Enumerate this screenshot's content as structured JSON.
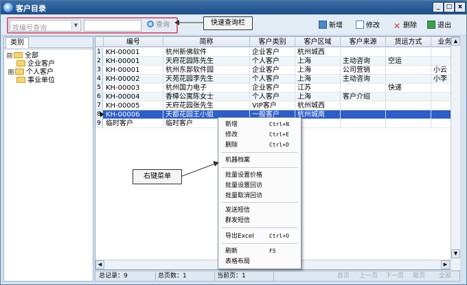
{
  "window": {
    "title": "客户目录"
  },
  "window_controls": {
    "minimize": "_",
    "maximize": "□",
    "close": "x"
  },
  "toolbar": {
    "search_placeholder": "按编号查询",
    "search_button": "查询",
    "add_label": "新增",
    "edit_label": "修改",
    "delete_label": "删除",
    "exit_label": "退出"
  },
  "annotations": {
    "quick_query_bar": "快速查询栏",
    "right_click_menu": "右键菜单"
  },
  "left_pane": {
    "tab_label": "类别",
    "tree": [
      {
        "label": "全部",
        "expander": "⊟"
      },
      {
        "label": "企业客户"
      },
      {
        "label": "个人客户",
        "expander": "⊞"
      },
      {
        "label": "事业单位"
      }
    ]
  },
  "grid": {
    "columns": [
      "编号",
      "简称",
      "客户类别",
      "客户区域",
      "客户来源",
      "货运方式",
      "业务"
    ],
    "rows": [
      {
        "num": "1",
        "cells": [
          "KH-00001",
          "杭州新佛软件",
          "企业客户",
          "杭州城西",
          "",
          "",
          ""
        ]
      },
      {
        "num": "2",
        "cells": [
          "KH-00001",
          "天府花园陈先生",
          "个人客户",
          "上海",
          "主动咨询",
          "空运",
          ""
        ]
      },
      {
        "num": "3",
        "cells": [
          "KH-00001",
          "杭州东部软件园",
          "企业客户",
          "上海",
          "公司营销",
          "",
          "小云"
        ]
      },
      {
        "num": "4",
        "cells": [
          "KH-00002",
          "天苑花园李先生",
          "个人客户",
          "上海",
          "主动咨询",
          "",
          "小李"
        ]
      },
      {
        "num": "5",
        "cells": [
          "KH-00003",
          "杭州国力电子",
          "企业客户",
          "江苏",
          "",
          "快递",
          ""
        ]
      },
      {
        "num": "6",
        "cells": [
          "KH-00004",
          "香樟公寓陈女士",
          "个人客户",
          "上海",
          "客户介绍",
          "",
          ""
        ]
      },
      {
        "num": "7",
        "cells": [
          "KH-00005",
          "天府花园张先生",
          "VIP客户",
          "杭州城西",
          "",
          "",
          ""
        ]
      },
      {
        "num": "8",
        "cells": [
          "KH-00006",
          "天都花园王小姐",
          "一般客户",
          "杭州城南",
          "",
          "",
          ""
        ],
        "selected": true
      },
      {
        "num": "9",
        "cells": [
          "临时客户",
          "临时客户",
          "",
          "",
          "",
          "",
          ""
        ]
      }
    ]
  },
  "context_menu": {
    "items": [
      {
        "label": "新增",
        "shortcut": "Ctrl+N"
      },
      {
        "label": "修改",
        "shortcut": "Ctrl+E"
      },
      {
        "label": "删除",
        "shortcut": "Ctrl+D"
      },
      {
        "label": "机器档案",
        "shortcut": ""
      },
      {
        "label": "批量设置价格",
        "shortcut": ""
      },
      {
        "label": "批量设置回访",
        "shortcut": ""
      },
      {
        "label": "批量取消回访",
        "shortcut": ""
      },
      {
        "label": "发送短信",
        "shortcut": ""
      },
      {
        "label": "群发短信",
        "shortcut": ""
      },
      {
        "label": "导出Excel",
        "shortcut": "Ctrl+O"
      },
      {
        "label": "刷新",
        "shortcut": "F5"
      },
      {
        "label": "表格布局",
        "shortcut": ""
      }
    ]
  },
  "status_bar": {
    "total_records": "总记录：9",
    "total_pages": "总页数：1",
    "current_page": "当前页：1",
    "first_page": "首页",
    "prev_page": "上一页",
    "next_page": "下一页",
    "last_page": "尾页",
    "all": "全部"
  },
  "colors": {
    "titlebar": "#1d4f8a",
    "selected_row": "#2b5ec8",
    "callout_border": "#e0607a",
    "alt_row": "#eef6f9"
  }
}
